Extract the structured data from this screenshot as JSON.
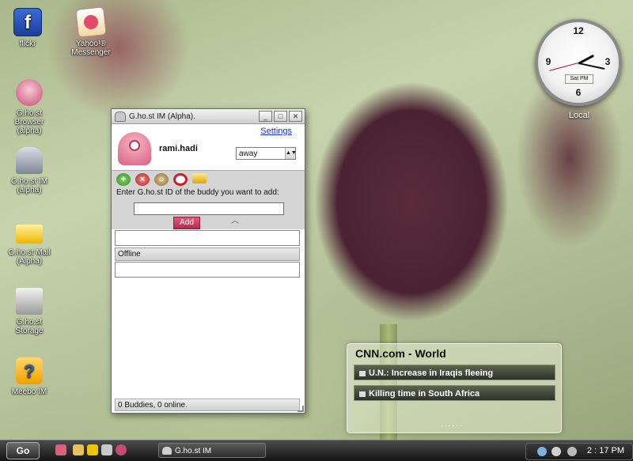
{
  "desktop": {
    "icons": [
      {
        "label": "flickr",
        "icon": "flickr-icon"
      },
      {
        "label": "Yahoo!® Messenger",
        "icon": "yahoo-messenger-icon"
      },
      {
        "label": "G.ho.st Browser (alpha)",
        "icon": "ghost-browser-icon"
      },
      {
        "label": "G.ho.st IM (alpha)",
        "icon": "ghost-im-icon"
      },
      {
        "label": "G.ho.st Mail (Alpha)",
        "icon": "ghost-mail-icon"
      },
      {
        "label": "G.ho.st Storage",
        "icon": "ghost-storage-icon"
      },
      {
        "label": "Meebo IM",
        "icon": "meebo-icon"
      }
    ]
  },
  "clock_gadget": {
    "numerals": {
      "n12": "12",
      "n3": "3",
      "n6": "6",
      "n9": "9"
    },
    "date": "Sat PM",
    "label": "Local"
  },
  "im_window": {
    "title": "G.ho.st IM (Alpha).",
    "settings_link": "Settings",
    "username": "rami.hadi",
    "status": "away",
    "add_prompt": "Enter G.ho.st ID of the buddy you want to add:",
    "add_button": "Add",
    "group_label": "Offline",
    "footer": "0 Buddies, 0 online.",
    "title_buttons": {
      "minimize": "_",
      "maximize": "□",
      "close": "✕"
    }
  },
  "cnn_gadget": {
    "title": "CNN.com - World",
    "headlines": [
      "U.N.: Increase in Iraqis fleeing",
      "Killing time in South Africa"
    ],
    "more": "......"
  },
  "taskbar": {
    "start_label": "Go",
    "tasks": [
      {
        "label": "G.ho.st IM"
      }
    ],
    "time": "2 : 17 PM"
  },
  "colors": {
    "accent_pink": "#c83a5e",
    "link_blue": "#1a33c8",
    "taskbar_dark": "#1b1b1b"
  }
}
